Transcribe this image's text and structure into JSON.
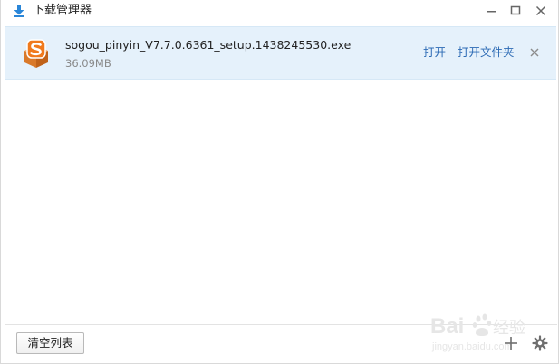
{
  "window": {
    "title": "下载管理器"
  },
  "downloads": [
    {
      "file_name": "sogou_pinyin_V7.7.0.6361_setup.1438245530.exe",
      "file_size": "36.09MB",
      "icon": "sogou-pinyin-app-icon",
      "actions": {
        "open": "打开",
        "open_folder": "打开文件夹"
      }
    }
  ],
  "footer": {
    "clear_list": "清空列表"
  },
  "watermark": {
    "text": "Baidu经验",
    "subtext": "jingyan.baidu.com"
  },
  "colors": {
    "item_background": "#e5f1fb",
    "link": "#2d6bb5",
    "download_icon": "#2a86d8",
    "sogou_orange": "#f07a1d"
  }
}
